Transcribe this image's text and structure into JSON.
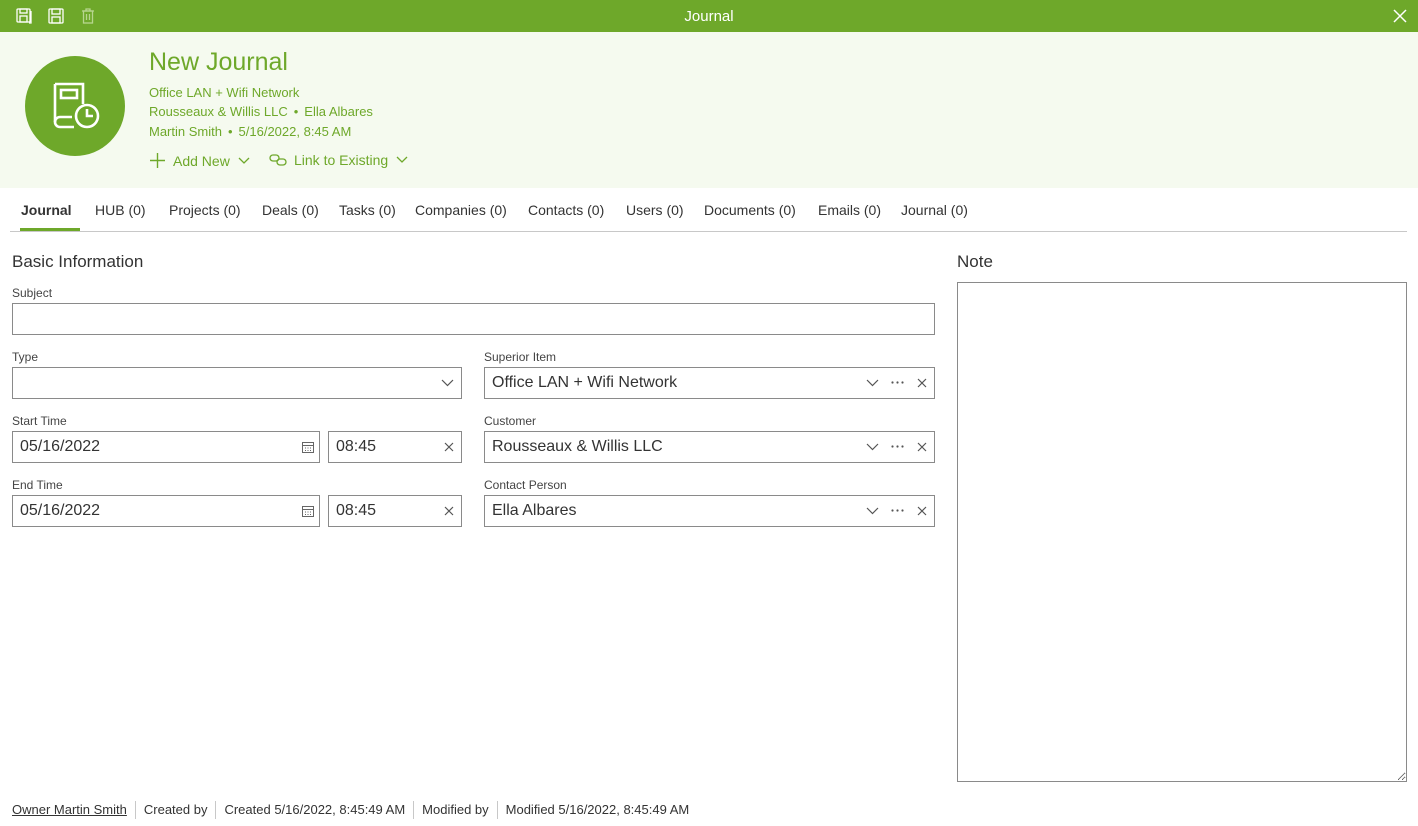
{
  "window": {
    "title": "Journal"
  },
  "header": {
    "title": "New Journal",
    "superior_item": "Office LAN + Wifi Network",
    "customer": "Rousseaux & Willis LLC",
    "contact": "Ella Albares",
    "owner": "Martin Smith",
    "created": "5/16/2022, 8:45 AM",
    "separator": "•",
    "add_new_label": "Add New",
    "link_existing_label": "Link to Existing"
  },
  "tabs": [
    {
      "label": "Journal"
    },
    {
      "label": "HUB (0)"
    },
    {
      "label": "Projects (0)"
    },
    {
      "label": "Deals (0)"
    },
    {
      "label": "Tasks (0)"
    },
    {
      "label": "Companies (0)"
    },
    {
      "label": "Contacts (0)"
    },
    {
      "label": "Users (0)"
    },
    {
      "label": "Documents (0)"
    },
    {
      "label": "Emails (0)"
    },
    {
      "label": "Journal (0)"
    }
  ],
  "basic": {
    "title": "Basic Information",
    "subject_label": "Subject",
    "subject_value": "",
    "type_label": "Type",
    "type_value": "",
    "start_label": "Start Time",
    "start_date": "05/16/2022",
    "start_time": "08:45",
    "end_label": "End Time",
    "end_date": "05/16/2022",
    "end_time": "08:45",
    "superior_label": "Superior Item",
    "superior_value": "Office LAN + Wifi Network",
    "customer_label": "Customer",
    "customer_value": "Rousseaux & Willis LLC",
    "contact_label": "Contact Person",
    "contact_value": "Ella Albares"
  },
  "note": {
    "title": "Note",
    "value": ""
  },
  "footer": {
    "owner": "Owner Martin Smith",
    "created_by": "Created by",
    "created": "Created 5/16/2022, 8:45:49 AM",
    "modified_by": "Modified by",
    "modified": "Modified 5/16/2022, 8:45:49 AM"
  },
  "colors": {
    "accent": "#6ea82a",
    "header_bg": "#f5faef"
  }
}
